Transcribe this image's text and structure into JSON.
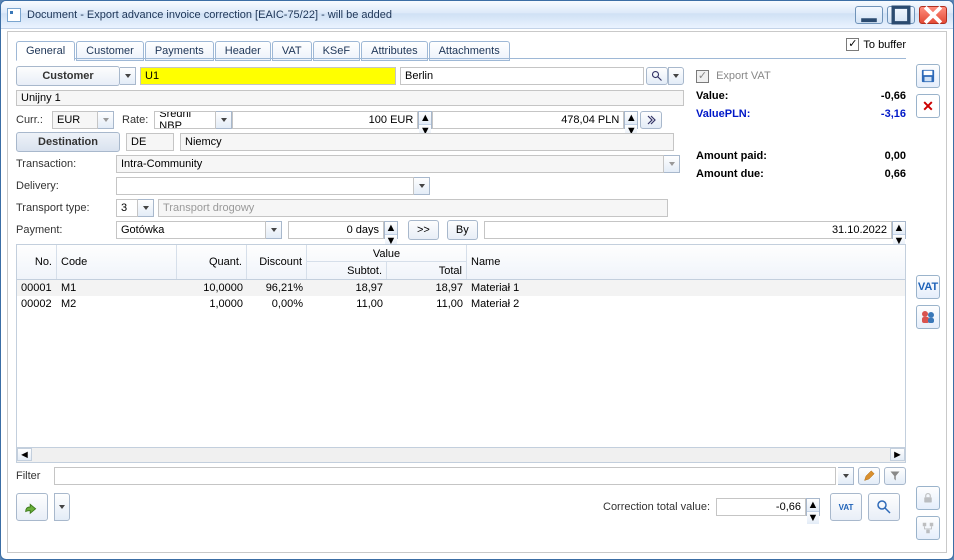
{
  "window": {
    "title": "Document - Export advance invoice correction [EAIC-75/22]  - will be added"
  },
  "tabs": {
    "general": "General",
    "customer": "Customer",
    "payments": "Payments",
    "header": "Header",
    "vat": "VAT",
    "ksef": "KSeF",
    "attributes": "Attributes",
    "attachments": "Attachments"
  },
  "toBuffer": {
    "label": "To buffer",
    "checked": true
  },
  "customer": {
    "button": "Customer",
    "code": "U1",
    "city": "Berlin",
    "name": "Unijny 1",
    "exportVatLabel": "Export VAT"
  },
  "currency": {
    "label": "Curr.:",
    "value": "EUR",
    "rateLabel": "Rate:",
    "rateType": "Średni NBP",
    "amountEur": "100 EUR",
    "amountPln": "478,04 PLN"
  },
  "destination": {
    "button": "Destination",
    "code": "DE",
    "name": "Niemcy"
  },
  "transaction": {
    "label": "Transaction:",
    "value": "Intra-Community"
  },
  "delivery": {
    "label": "Delivery:"
  },
  "transport": {
    "label": "Transport type:",
    "code": "3",
    "desc": "Transport drogowy"
  },
  "payment": {
    "label": "Payment:",
    "method": "Gotówka",
    "days": "0 days",
    "go": ">>",
    "by": "By",
    "date": "31.10.2022"
  },
  "summary": {
    "valueLabel": "Value:",
    "value": "-0,66",
    "valuePlnLabel": "ValuePLN:",
    "valuePln": "-3,16",
    "paidLabel": "Amount paid:",
    "paid": "0,00",
    "dueLabel": "Amount due:",
    "due": "0,66"
  },
  "columns": {
    "no": "No.",
    "code": "Code",
    "quant": "Quant.",
    "discount": "Discount",
    "value": "Value",
    "subtot": "Subtot.",
    "total": "Total",
    "name": "Name"
  },
  "lines": [
    {
      "no": "00001",
      "code": "M1",
      "quant": "10,0000",
      "discount": "96,21%",
      "subtot": "18,97",
      "total": "18,97",
      "name": "Materiał 1"
    },
    {
      "no": "00002",
      "code": "M2",
      "quant": "1,0000",
      "discount": "0,00%",
      "subtot": "11,00",
      "total": "11,00",
      "name": "Materiał 2"
    }
  ],
  "filter": {
    "label": "Filter"
  },
  "correction": {
    "label": "Correction total value:",
    "value": "-0,66"
  },
  "icons": {
    "vat": "VAT"
  }
}
